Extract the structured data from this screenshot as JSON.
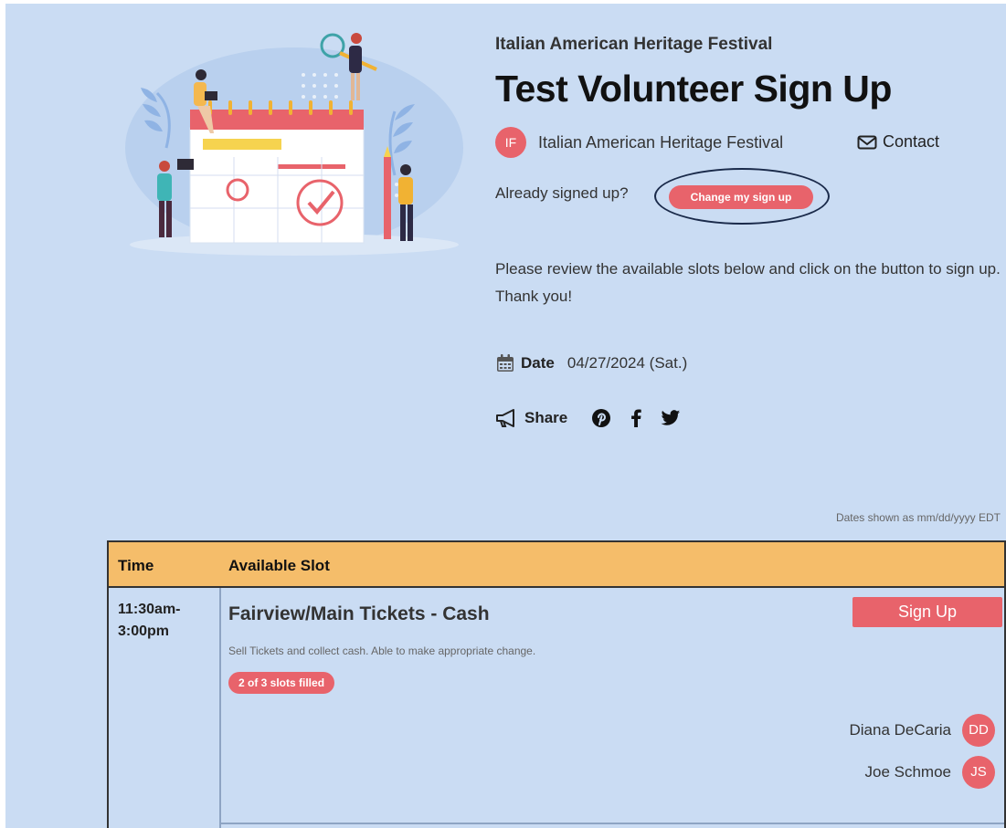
{
  "header": {
    "org_title": "Italian American Heritage Festival",
    "title": "Test Volunteer Sign Up"
  },
  "organizer": {
    "initials": "IF",
    "name": "Italian American Heritage Festival",
    "contact_label": "Contact"
  },
  "already": {
    "prompt": "Already signed up?",
    "change_label": "Change my sign up"
  },
  "instructions": "Please review the available slots below and click on the button to sign up. Thank you!",
  "date": {
    "label": "Date",
    "value": "04/27/2024 (Sat.)"
  },
  "share": {
    "label": "Share",
    "networks": [
      "pinterest-icon",
      "facebook-icon",
      "twitter-icon"
    ]
  },
  "timezone_note": "Dates shown as mm/dd/yyyy EDT",
  "table": {
    "columns": [
      "Time",
      "Available Slot"
    ],
    "rows": [
      {
        "time_start": "11:30am-",
        "time_end": "3:00pm",
        "slot_title": "Fairview/Main Tickets - Cash",
        "description": "Sell Tickets and collect cash. Able to make appropriate change.",
        "badge": "2 of 3 slots filled",
        "signup_label": "Sign Up",
        "volunteers": [
          {
            "name": "Diana DeCaria",
            "initials": "DD"
          },
          {
            "name": "Joe Schmoe",
            "initials": "JS"
          }
        ]
      }
    ]
  },
  "colors": {
    "background": "#cadcf3",
    "accent": "#e8636b",
    "table_header": "#f5bd6a"
  }
}
